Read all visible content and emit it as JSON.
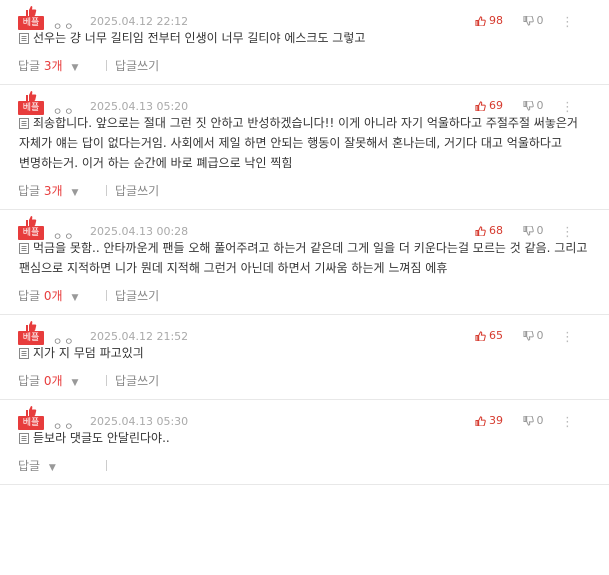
{
  "colors": {
    "accent": "#e73c3c",
    "muted": "#888888"
  },
  "comments": [
    {
      "badge": "베플",
      "user_icons": "ㅇㅇ",
      "date": "2025.04.12 22:12",
      "up": "98",
      "down": "0",
      "text": "선우는 걍 너무 길티임 전부터 인생이 너무 길티야 에스크도 그렇고",
      "reply_label": "답글",
      "reply_count": "3개",
      "write_label": "답글쓰기"
    },
    {
      "badge": "베플",
      "user_icons": "ㅇㅇ",
      "date": "2025.04.13 05:20",
      "up": "69",
      "down": "0",
      "text": "죄송합니다. 앞으로는 절대 그런 짓 안하고 반성하겠습니다!! 이게 아니라 자기 억울하다고 주절주절 써놓은거 자체가 얘는 답이 없다는거임. 사회에서 제일 하면 안되는 행동이 잘못해서 혼나는데, 거기다 대고 억울하다고 변명하는거. 이거 하는 순간에 바로 폐급으로 낙인 찍힘",
      "reply_label": "답글",
      "reply_count": "3개",
      "write_label": "답글쓰기"
    },
    {
      "badge": "베플",
      "user_icons": "ㅇㅇ",
      "date": "2025.04.13 00:28",
      "up": "68",
      "down": "0",
      "text": "먹금을 못함.. 안타까운게 팬들 오해 풀어주려고 하는거 같은데 그게 일을 더 키운다는걸 모르는 것 같음. 그리고 팬심으로 지적하면 니가 뭔데 지적해 그런거 아닌데 하면서 기싸움 하는게 느껴짐 에휴",
      "reply_label": "답글",
      "reply_count": "0개",
      "write_label": "답글쓰기"
    },
    {
      "badge": "베플",
      "user_icons": "ㅇㅇ",
      "date": "2025.04.12 21:52",
      "up": "65",
      "down": "0",
      "text": "지가 지 무덤 파고있긔",
      "reply_label": "답글",
      "reply_count": "0개",
      "write_label": "답글쓰기"
    },
    {
      "badge": "베플",
      "user_icons": "ㅇㅇ",
      "date": "2025.04.13 05:30",
      "up": "39",
      "down": "0",
      "text": "듣보라 댓글도 안달린다야..",
      "reply_label": "답글",
      "reply_count": "",
      "write_label": ""
    }
  ]
}
